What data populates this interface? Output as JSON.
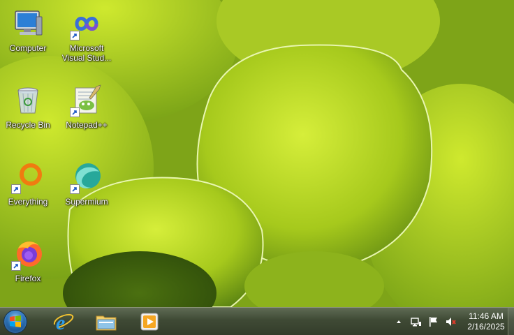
{
  "desktop": {
    "icons": [
      {
        "label": "Computer",
        "icon": "computer-icon",
        "shortcut": false
      },
      {
        "label": "Microsoft\nVisual Stud...",
        "icon": "visual-studio-icon",
        "shortcut": true
      },
      {
        "label": "Recycle Bin",
        "icon": "recycle-bin-icon",
        "shortcut": false
      },
      {
        "label": "Notepad++",
        "icon": "notepad-plus-plus-icon",
        "shortcut": true
      },
      {
        "label": "Everything",
        "icon": "everything-search-icon",
        "shortcut": true
      },
      {
        "label": "Supermium",
        "icon": "supermium-browser-icon",
        "shortcut": true
      },
      {
        "label": "Firefox",
        "icon": "firefox-icon",
        "shortcut": true
      }
    ]
  },
  "taskbar": {
    "start_icon": "windows-start-orb-icon",
    "pinned": [
      {
        "icon": "internet-explorer-icon"
      },
      {
        "icon": "file-explorer-icon"
      },
      {
        "icon": "media-player-icon"
      }
    ],
    "tray": {
      "icons": [
        "show-hidden-icons-chevron",
        "network-icon",
        "action-center-flag-icon",
        "volume-muted-icon"
      ],
      "time": "11:46 AM",
      "date": "2/16/2025"
    }
  },
  "colors": {
    "wallpaper_base": "#6e9a12",
    "leaf_light": "#c7e22a",
    "taskbar": "#3f4a35"
  }
}
